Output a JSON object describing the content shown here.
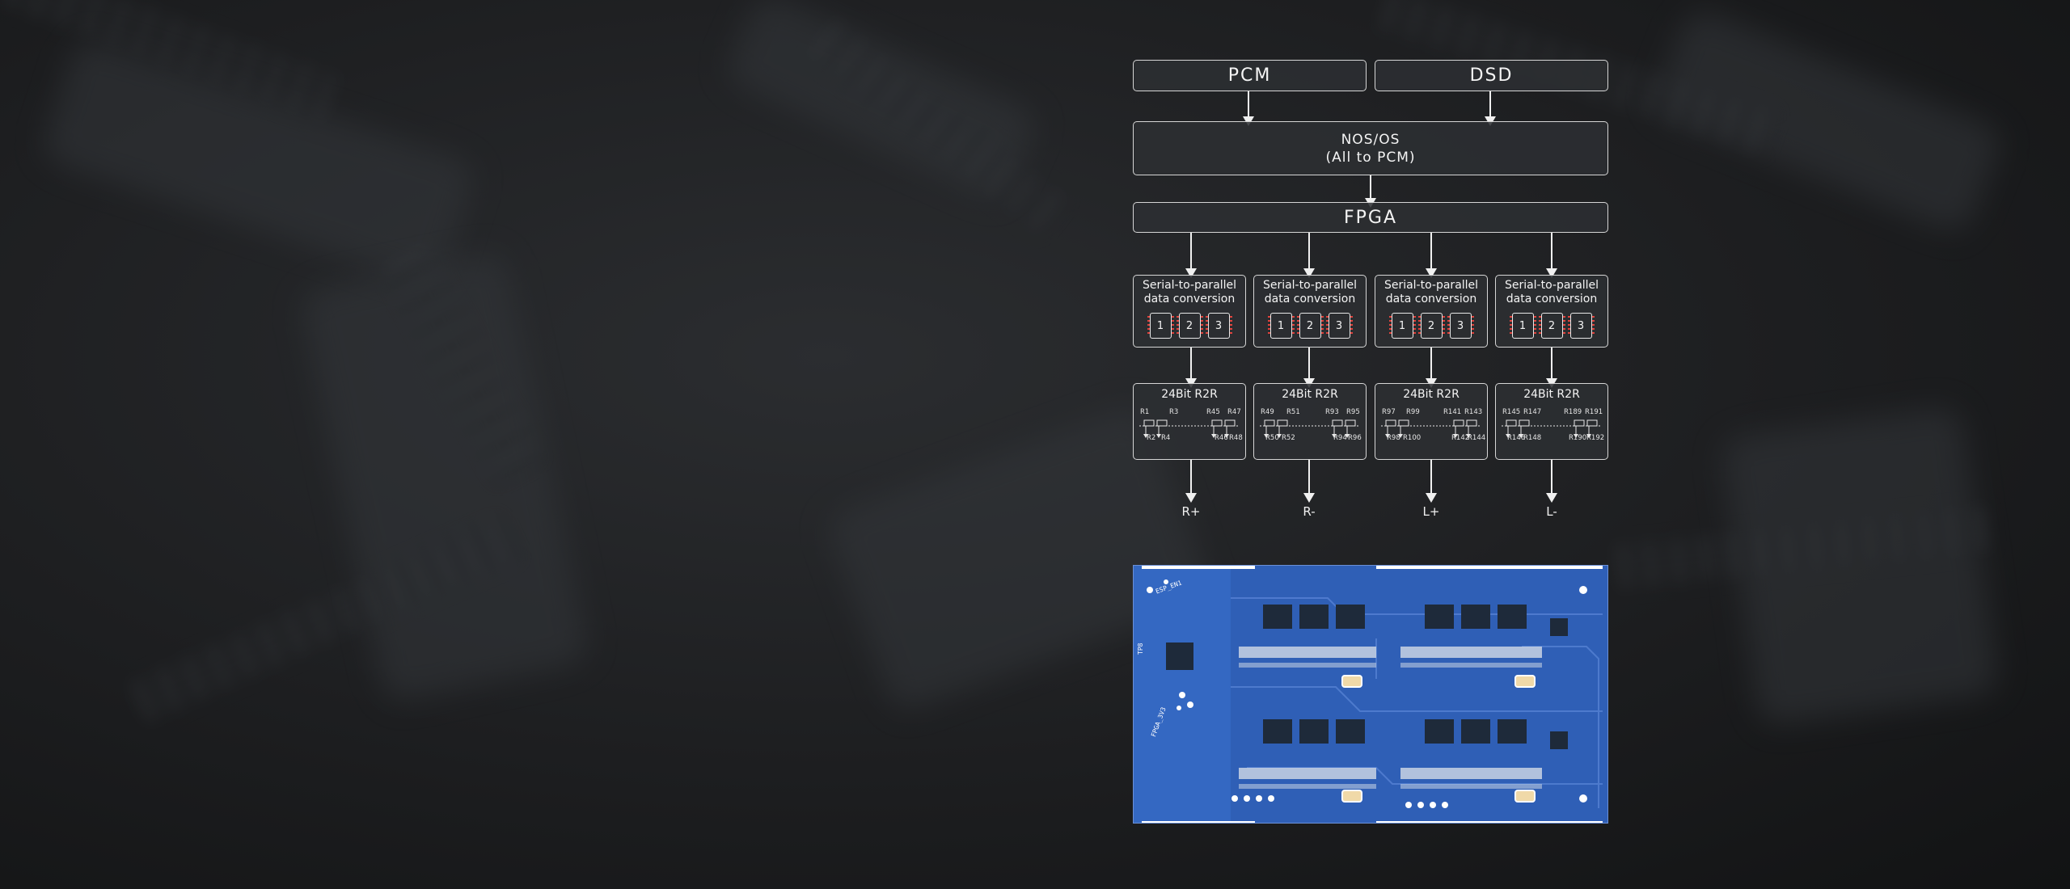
{
  "diagram": {
    "inputs": [
      "PCM",
      "DSD"
    ],
    "nos": {
      "line1": "NOS/OS",
      "line2": "(All to PCM)"
    },
    "fpga": "FPGA",
    "channels": [
      {
        "conv_line1": "Serial-to-parallel",
        "conv_line2": "data conversion",
        "chips": [
          "1",
          "2",
          "3"
        ],
        "r2r": "24Bit R2R",
        "top_labels": [
          "R1",
          "R3",
          "R45",
          "R47"
        ],
        "bottom_labels": [
          "R2",
          "R4",
          "R46",
          "R48"
        ],
        "output": "R+"
      },
      {
        "conv_line1": "Serial-to-parallel",
        "conv_line2": "data conversion",
        "chips": [
          "1",
          "2",
          "3"
        ],
        "r2r": "24Bit R2R",
        "top_labels": [
          "R49",
          "R51",
          "R93",
          "R95"
        ],
        "bottom_labels": [
          "R50",
          "R52",
          "R94",
          "R96"
        ],
        "output": "R-"
      },
      {
        "conv_line1": "Serial-to-parallel",
        "conv_line2": "data conversion",
        "chips": [
          "1",
          "2",
          "3"
        ],
        "r2r": "24Bit R2R",
        "top_labels": [
          "R97",
          "R99",
          "R141",
          "R143"
        ],
        "bottom_labels": [
          "R98",
          "R100",
          "R142",
          "R144"
        ],
        "output": "L+"
      },
      {
        "conv_line1": "Serial-to-parallel",
        "conv_line2": "data conversion",
        "chips": [
          "1",
          "2",
          "3"
        ],
        "r2r": "24Bit R2R",
        "top_labels": [
          "R145",
          "R147",
          "R189",
          "R191"
        ],
        "bottom_labels": [
          "R146",
          "R148",
          "R190",
          "R192"
        ],
        "output": "L-"
      }
    ]
  },
  "pcb": {
    "silkscreen": [
      "TP8",
      "FPGA_3V3",
      "ESP_EN1"
    ],
    "color": "#3468c2"
  }
}
